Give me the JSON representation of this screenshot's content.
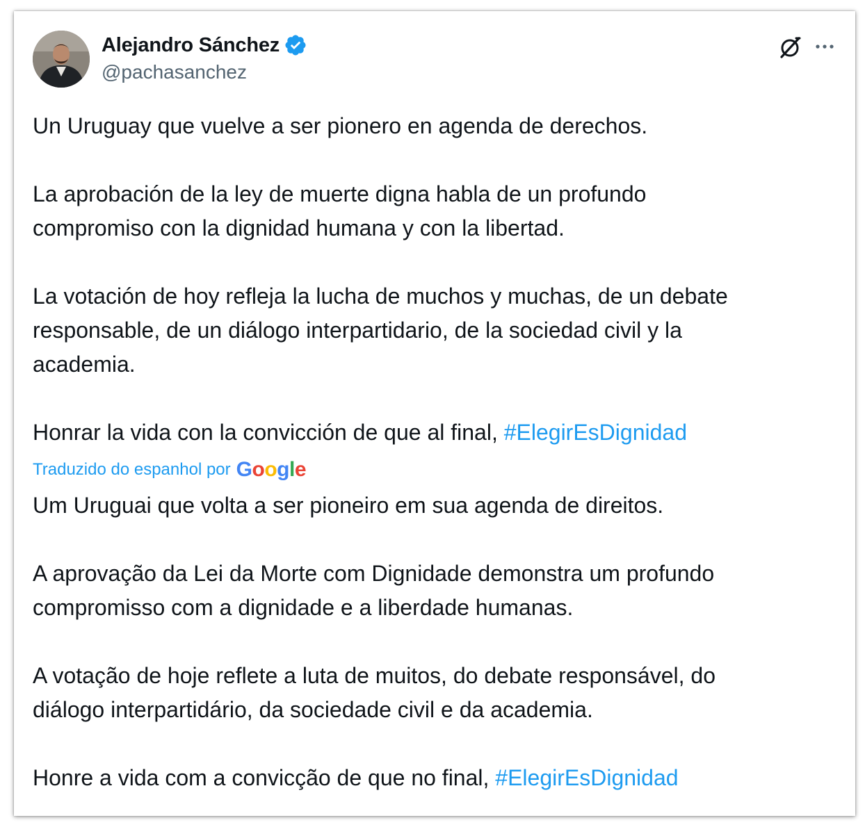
{
  "author": {
    "name": "Alejandro Sánchez",
    "handle": "@pachasanchez",
    "verified": true,
    "verified_color": "#1d9bf0"
  },
  "header_icons": {
    "grok_icon": "slashed-circle-icon",
    "more_icon": "more-horizontal-icon"
  },
  "original": {
    "p1": "Un Uruguay que vuelve a ser pionero en agenda de derechos.",
    "p2_l1": "La aprobación de la ley de muerte digna habla de un profundo",
    "p2_l2": "compromiso con la dignidad humana y con la libertad.",
    "p3_l1": "La votación de hoy refleja la lucha de muchos y muchas, de un debate",
    "p3_l2": "responsable, de un diálogo interpartidario, de la sociedad civil y la",
    "p3_l3": "academia.",
    "p4_text": "Honrar la vida con la convicción de que al final, ",
    "p4_hashtag": "#ElegirEsDignidad"
  },
  "translation": {
    "label": "Traduzido do espanhol por",
    "provider": "Google",
    "p1": "Um Uruguai que volta a ser pioneiro em sua agenda de direitos.",
    "p2_l1": "A aprovação da Lei da Morte com Dignidade demonstra um profundo",
    "p2_l2": "compromisso com a dignidade e a liberdade humanas.",
    "p3_l1": "A votação de hoje reflete a luta de muitos, do debate responsável, do",
    "p3_l2": "diálogo interpartidário, da sociedade civil e da academia.",
    "p4_text": "Honre a vida com a convicção de que no final, ",
    "p4_hashtag": "#ElegirEsDignidad"
  },
  "colors": {
    "text": "#0f1419",
    "secondary": "#536471",
    "link": "#1d9bf0"
  }
}
